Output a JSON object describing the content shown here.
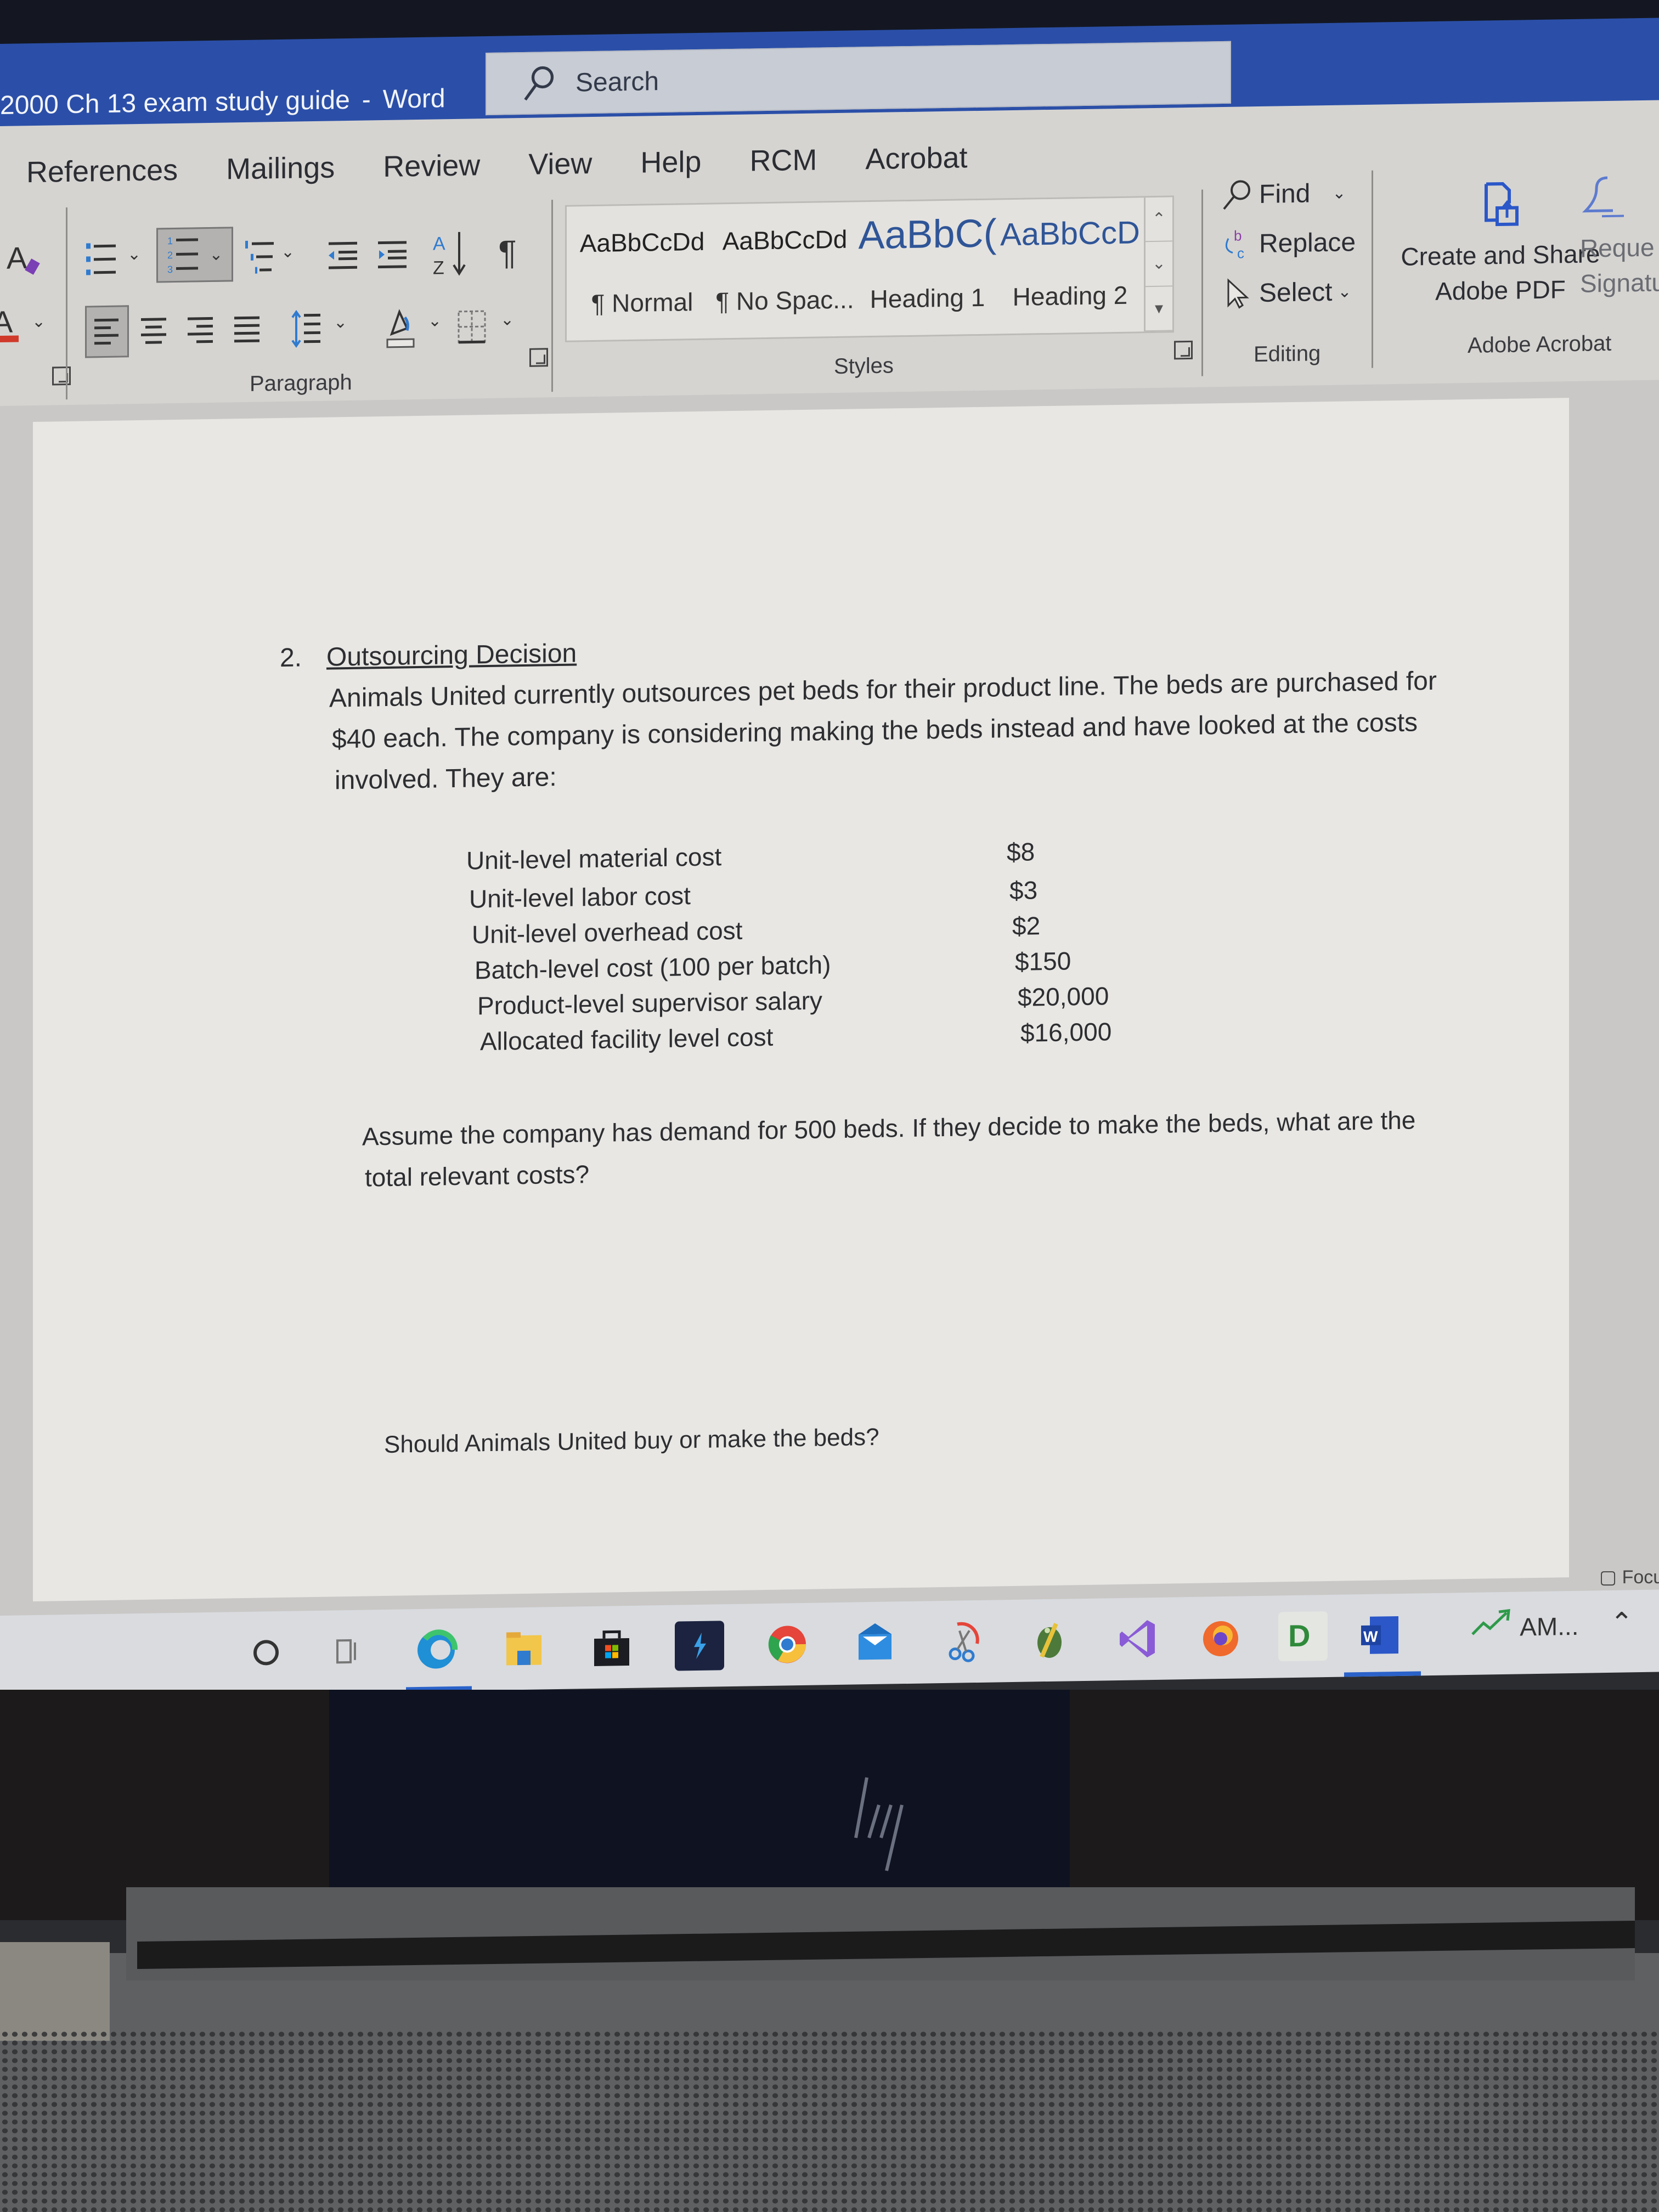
{
  "window": {
    "document_title": "2000 Ch 13 exam study guide",
    "separator": "-",
    "app_name": "Word"
  },
  "search": {
    "placeholder": "Search",
    "icon": "search-icon"
  },
  "ribbon": {
    "tabs": [
      {
        "label": "References"
      },
      {
        "label": "Mailings"
      },
      {
        "label": "Review"
      },
      {
        "label": "View"
      },
      {
        "label": "Help"
      },
      {
        "label": "RCM"
      },
      {
        "label": "Acrobat"
      }
    ],
    "groups": {
      "paragraph": {
        "label": "Paragraph",
        "buttons": [
          {
            "name": "bullets",
            "icon": "bullets-icon"
          },
          {
            "name": "numbering",
            "icon": "numbering-icon",
            "selected": true
          },
          {
            "name": "multilevel-list",
            "icon": "multilevel-list-icon"
          },
          {
            "name": "decrease-indent",
            "icon": "decrease-indent-icon"
          },
          {
            "name": "increase-indent",
            "icon": "increase-indent-icon"
          },
          {
            "name": "sort",
            "icon": "sort-az-icon",
            "glyph": "A↓"
          },
          {
            "name": "show-hide",
            "icon": "pilcrow-icon",
            "glyph": "¶"
          },
          {
            "name": "align-left",
            "icon": "align-left-icon",
            "selected": true
          },
          {
            "name": "align-center",
            "icon": "align-center-icon"
          },
          {
            "name": "align-right",
            "icon": "align-right-icon"
          },
          {
            "name": "justify",
            "icon": "justify-icon"
          },
          {
            "name": "line-spacing",
            "icon": "line-spacing-icon"
          },
          {
            "name": "shading",
            "icon": "shading-icon"
          },
          {
            "name": "borders",
            "icon": "borders-icon"
          }
        ]
      },
      "styles": {
        "label": "Styles",
        "items": [
          {
            "sample": "AaBbCcDd",
            "name": "¶ Normal",
            "color": "#222222"
          },
          {
            "sample": "AaBbCcDd",
            "name": "¶ No Spac...",
            "color": "#222222"
          },
          {
            "sample": "AaBbC(",
            "name": "Heading 1",
            "color": "#2f5597"
          },
          {
            "sample": "AaBbCcD",
            "name": "Heading 2",
            "color": "#2f5597"
          }
        ]
      },
      "editing": {
        "label": "Editing",
        "find": "Find",
        "replace": "Replace",
        "select": "Select"
      },
      "adobe_acrobat": {
        "label": "Adobe Acrobat",
        "create_share_line1": "Create and Share",
        "create_share_line2": "Adobe PDF",
        "request_line1": "Reque",
        "request_line2": "Signatu"
      }
    }
  },
  "document": {
    "item_number": "2.",
    "heading": "Outsourcing Decision",
    "intro_lines": [
      "Animals United currently outsources pet beds for their product line.  The beds are purchased for",
      "$40 each.  The company is considering making the beds instead and have looked at the costs",
      "involved.  They are:"
    ],
    "costs": [
      {
        "label": "Unit-level material cost",
        "value": "$8"
      },
      {
        "label": "Unit-level labor cost",
        "value": "$3"
      },
      {
        "label": "Unit-level overhead cost",
        "value": "$2"
      },
      {
        "label": "Batch-level cost (100 per batch)",
        "value": "$150"
      },
      {
        "label": "Product-level supervisor salary",
        "value": "$20,000"
      },
      {
        "label": "Allocated facility level cost",
        "value": "$16,000"
      }
    ],
    "question1_lines": [
      "Assume the company has demand for 500 beds.  If they decide to make the beds, what are the",
      "total relevant costs?"
    ],
    "question2": "Should Animals United buy or make the beds?"
  },
  "statusbar": {
    "focus_label": "Focu"
  },
  "taskbar": {
    "items": [
      {
        "name": "cortana",
        "icon": "cortana-circle-icon"
      },
      {
        "name": "task-view",
        "icon": "task-view-icon"
      },
      {
        "name": "edge",
        "icon": "edge-icon",
        "active": true
      },
      {
        "name": "file-explorer",
        "icon": "folder-icon"
      },
      {
        "name": "microsoft-store",
        "icon": "store-icon"
      },
      {
        "name": "power-automate",
        "icon": "lightning-app-icon"
      },
      {
        "name": "chrome",
        "icon": "chrome-icon"
      },
      {
        "name": "mail",
        "icon": "mail-icon"
      },
      {
        "name": "snipping-tool",
        "icon": "scissors-icon"
      },
      {
        "name": "frog-app",
        "icon": "frog-icon"
      },
      {
        "name": "visual-studio",
        "icon": "visual-studio-icon"
      },
      {
        "name": "firefox",
        "icon": "firefox-icon"
      },
      {
        "name": "quickbooks-desktop",
        "icon": "qb-icon"
      },
      {
        "name": "word",
        "icon": "word-icon",
        "active": true
      }
    ],
    "tray": {
      "stocks_label": "AM...",
      "overflow_icon": "chevron-up-icon"
    }
  },
  "device": {
    "brand_logo": "hp-logo"
  }
}
